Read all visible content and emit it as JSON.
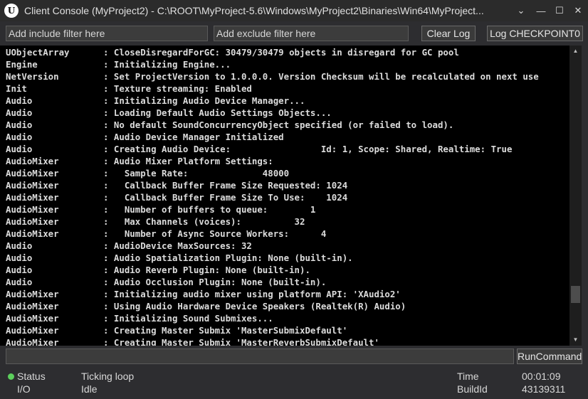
{
  "window": {
    "title": "Client Console (MyProject2) - C:\\ROOT\\MyProject-5.6\\Windows\\MyProject2\\Binaries\\Win64\\MyProject...",
    "logo_letter": "U",
    "menu_glyph": "⌄",
    "minimize_glyph": "—",
    "maximize_glyph": "☐",
    "close_glyph": "✕"
  },
  "filters": {
    "include_placeholder": "Add include filter here",
    "exclude_placeholder": "Add exclude filter here",
    "clear_log": "Clear Log",
    "log_checkpoint": "Log CHECKPOINT0"
  },
  "log": [
    {
      "category": "UObjectArray",
      "message": ": CloseDisregardForGC: 30479/30479 objects in disregard for GC pool"
    },
    {
      "category": "Engine",
      "message": ": Initializing Engine..."
    },
    {
      "category": "NetVersion",
      "message": ": Set ProjectVersion to 1.0.0.0. Version Checksum will be recalculated on next use"
    },
    {
      "category": "Init",
      "message": ": Texture streaming: Enabled"
    },
    {
      "category": "Audio",
      "message": ": Initializing Audio Device Manager..."
    },
    {
      "category": "Audio",
      "message": ": Loading Default Audio Settings Objects..."
    },
    {
      "category": "Audio",
      "message": ": No default SoundConcurrencyObject specified (or failed to load)."
    },
    {
      "category": "Audio",
      "message": ": Audio Device Manager Initialized"
    },
    {
      "category": "Audio",
      "message": ": Creating Audio Device:                 Id: 1, Scope: Shared, Realtime: True"
    },
    {
      "category": "AudioMixer",
      "message": ": Audio Mixer Platform Settings:"
    },
    {
      "category": "AudioMixer",
      "message": ":   Sample Rate:              48000"
    },
    {
      "category": "AudioMixer",
      "message": ":   Callback Buffer Frame Size Requested: 1024"
    },
    {
      "category": "AudioMixer",
      "message": ":   Callback Buffer Frame Size To Use:    1024"
    },
    {
      "category": "AudioMixer",
      "message": ":   Number of buffers to queue:        1"
    },
    {
      "category": "AudioMixer",
      "message": ":   Max Channels (voices):          32"
    },
    {
      "category": "AudioMixer",
      "message": ":   Number of Async Source Workers:      4"
    },
    {
      "category": "Audio",
      "message": ": AudioDevice MaxSources: 32"
    },
    {
      "category": "Audio",
      "message": ": Audio Spatialization Plugin: None (built-in)."
    },
    {
      "category": "Audio",
      "message": ": Audio Reverb Plugin: None (built-in)."
    },
    {
      "category": "Audio",
      "message": ": Audio Occlusion Plugin: None (built-in)."
    },
    {
      "category": "AudioMixer",
      "message": ": Initializing audio mixer using platform API: 'XAudio2'"
    },
    {
      "category": "AudioMixer",
      "message": ": Using Audio Hardware Device Speakers (Realtek(R) Audio)"
    },
    {
      "category": "AudioMixer",
      "message": ": Initializing Sound Submixes..."
    },
    {
      "category": "AudioMixer",
      "message": ": Creating Master Submix 'MasterSubmixDefault'"
    },
    {
      "category": "AudioMixer",
      "message": ": Creating Master Submix 'MasterReverbSubmixDefault'"
    }
  ],
  "scrollbar": {
    "up_glyph": "▲",
    "down_glyph": "▼",
    "position": 0.88
  },
  "command": {
    "value": "",
    "run_label": "RunCommand"
  },
  "status": {
    "rows": [
      {
        "label": "Status",
        "value": "Ticking loop",
        "indicator_color": "#5ccf5c"
      },
      {
        "label": "I/O",
        "value": "Idle"
      }
    ],
    "time_label": "Time",
    "time_value": "00:01:09",
    "buildid_label": "BuildId",
    "buildid_value": "43139311"
  }
}
